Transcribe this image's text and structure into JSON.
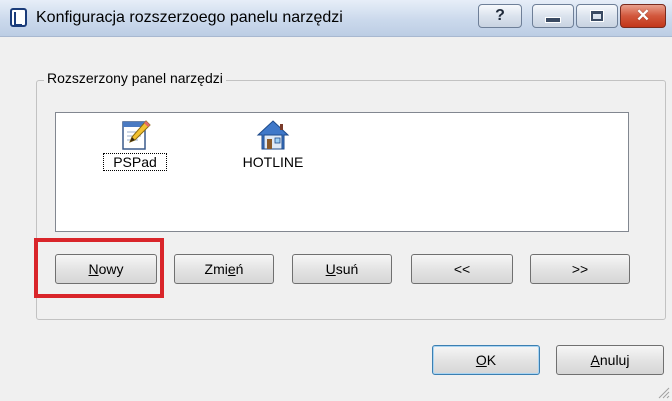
{
  "window": {
    "title": "Konfiguracja rozszerzoego panelu narzędzi",
    "help_label": "?",
    "minimize_icon": "minimize-icon",
    "maximize_icon": "maximize-icon",
    "close_icon": "close-icon"
  },
  "group": {
    "legend": "Rozszerzony panel narzędzi",
    "items": [
      {
        "label": "PSPad",
        "icon": "notepad-pencil-icon",
        "selected": true
      },
      {
        "label": "HOTLINE",
        "icon": "house-icon",
        "selected": false
      }
    ]
  },
  "buttons": {
    "new_label_mnemonic": "N",
    "new_label_rest": "owy",
    "edit_label_pre": "Zmi",
    "edit_label_mnemonic": "e",
    "edit_label_rest": "ń",
    "delete_label_mnemonic": "U",
    "delete_label_rest": "suń",
    "move_left_label": "<<",
    "move_right_label": ">>",
    "ok_label_mnemonic": "O",
    "ok_label_rest": "K",
    "cancel_label_mnemonic": "A",
    "cancel_label_rest": "nuluj"
  },
  "annotation": {
    "color": "#d9252a",
    "target": "Nowy"
  }
}
